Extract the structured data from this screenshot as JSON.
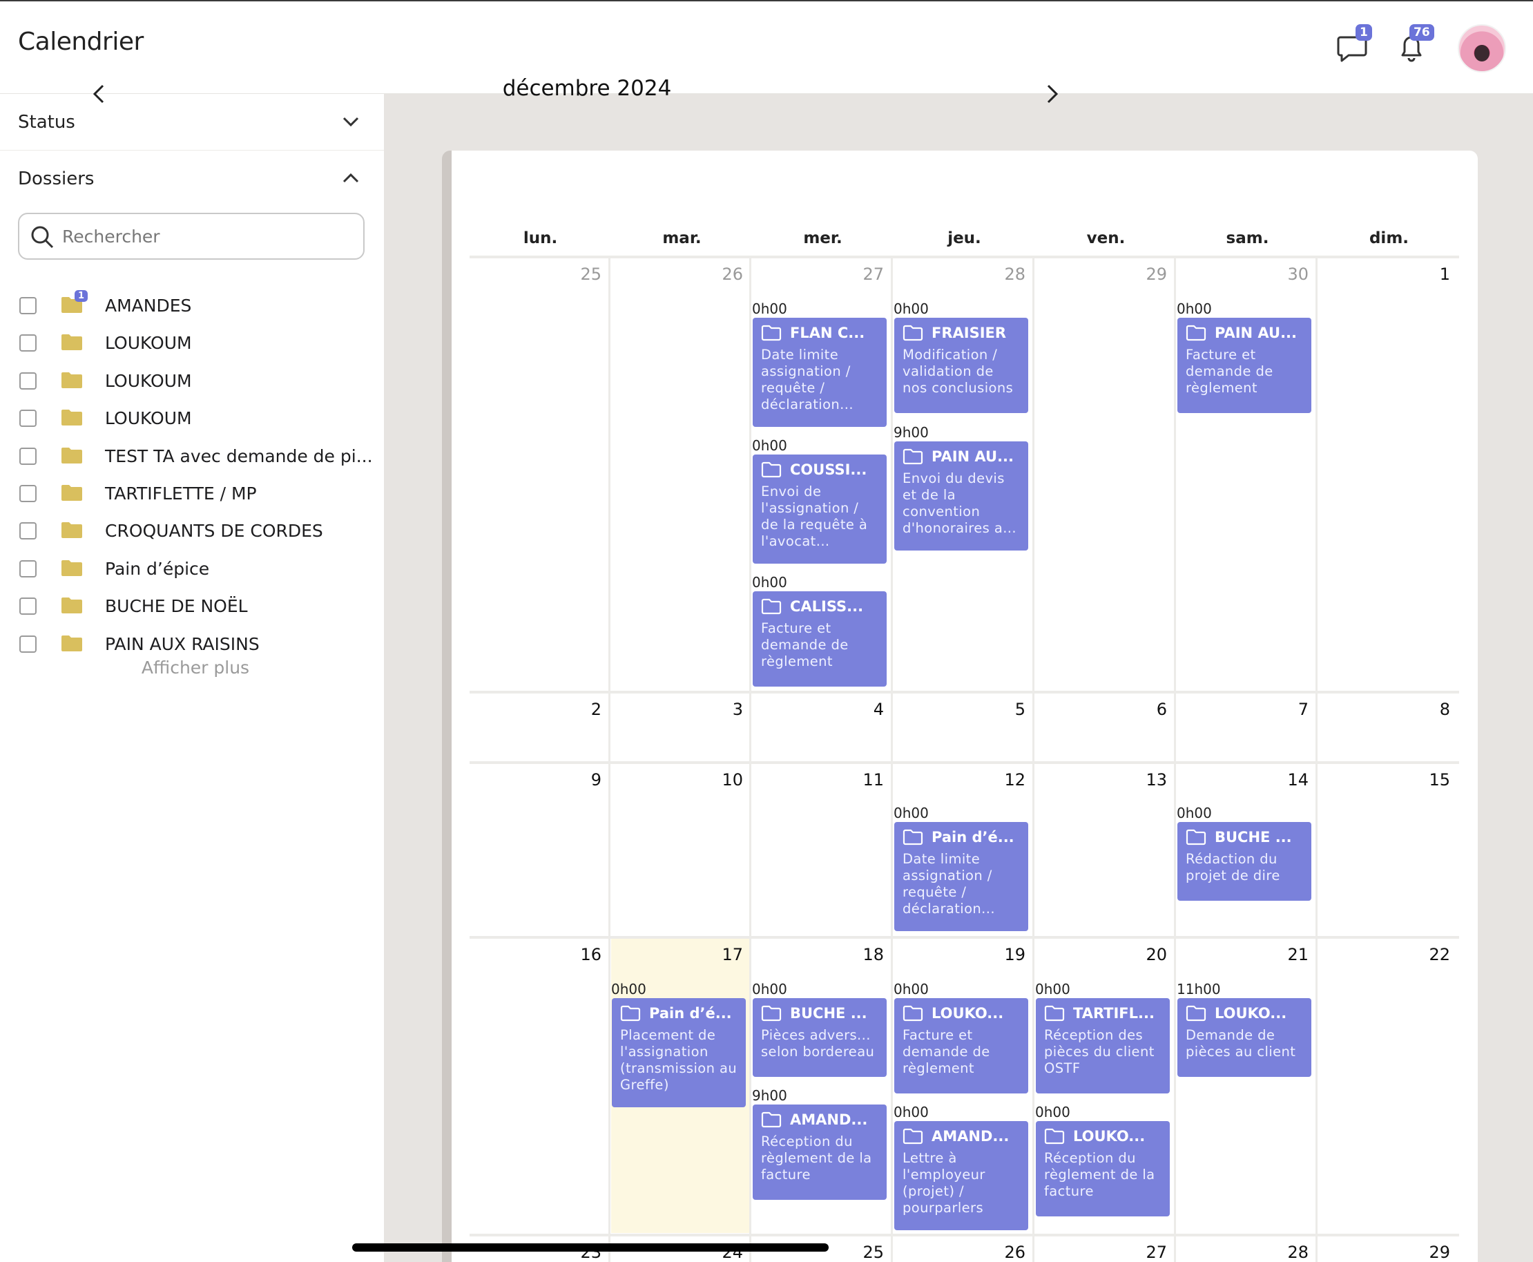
{
  "header": {
    "title": "Calendrier",
    "messages_badge": "1",
    "notifications_badge": "76"
  },
  "sidebar": {
    "status_label": "Status",
    "dossiers_label": "Dossiers",
    "search_placeholder": "Rechercher",
    "dossiers": [
      {
        "name": "AMANDES",
        "badge": "1"
      },
      {
        "name": "LOUKOUM"
      },
      {
        "name": "LOUKOUM"
      },
      {
        "name": "LOUKOUM"
      },
      {
        "name": "TEST TA avec demande de pi..."
      },
      {
        "name": "TARTIFLETTE / MP"
      },
      {
        "name": "CROQUANTS DE CORDES"
      },
      {
        "name": "Pain d’épice"
      },
      {
        "name": "BUCHE DE NOËL"
      },
      {
        "name": "PAIN AUX RAISINS"
      }
    ],
    "show_more": "Afficher plus"
  },
  "calendar": {
    "month_label": "décembre 2024",
    "weekdays": [
      "lun.",
      "mar.",
      "mer.",
      "jeu.",
      "ven.",
      "sam.",
      "dim."
    ],
    "weeks": [
      [
        "25",
        "26",
        "27",
        "28",
        "29",
        "30",
        "1"
      ],
      [
        "2",
        "3",
        "4",
        "5",
        "6",
        "7",
        "8"
      ],
      [
        "9",
        "10",
        "11",
        "12",
        "13",
        "14",
        "15"
      ],
      [
        "16",
        "17",
        "18",
        "19",
        "20",
        "21",
        "22"
      ],
      [
        "23",
        "24",
        "25",
        "26",
        "27",
        "28",
        "29"
      ]
    ],
    "events": [
      {
        "time": "0h00",
        "title": "FLAN C...",
        "desc": "Date limite assignation / requête / déclaration..."
      },
      {
        "time": "0h00",
        "title": "COUSSI...",
        "desc": "Envoi de l'assignation / de la requête à l'avocat..."
      },
      {
        "time": "0h00",
        "title": "CALISS...",
        "desc": "Facture et demande de règlement"
      },
      {
        "time": "0h00",
        "title": "FRAISIER",
        "desc": "Modification / validation de nos conclusions"
      },
      {
        "time": "9h00",
        "title": "PAIN AU...",
        "desc": "Envoi du devis et de la convention d'honoraires a..."
      },
      {
        "time": "0h00",
        "title": "PAIN AU...",
        "desc": "Facture et demande de règlement"
      },
      {
        "time": "0h00",
        "title": "Pain d’é...",
        "desc": "Date limite assignation / requête / déclaration..."
      },
      {
        "time": "0h00",
        "title": "BUCHE ...",
        "desc": "Rédaction du projet de dire"
      },
      {
        "time": "0h00",
        "title": "Pain d’é...",
        "desc": "Placement de l'assignation (transmission au Greffe)"
      },
      {
        "time": "0h00",
        "title": "BUCHE ...",
        "desc": "Pièces advers... selon bordereau"
      },
      {
        "time": "9h00",
        "title": "AMAND...",
        "desc": "Réception du règlement de la facture"
      },
      {
        "time": "0h00",
        "title": "LOUKO...",
        "desc": "Facture et demande de règlement"
      },
      {
        "time": "0h00",
        "title": "AMAND...",
        "desc": "Lettre à l'employeur (projet) / pourparlers"
      },
      {
        "time": "0h00",
        "title": "TARTIFL...",
        "desc": "Réception des pièces du client OSTF"
      },
      {
        "time": "0h00",
        "title": "LOUKO...",
        "desc": "Réception du règlement de la facture"
      },
      {
        "time": "11h00",
        "title": "LOUKO...",
        "desc": "Demande de pièces au client"
      }
    ]
  },
  "colors": {
    "event_bg": "#7a81db",
    "badge_bg": "#6b73d9",
    "folder": "#d9bf5e",
    "today_bg": "#fdf8e1",
    "main_bg": "#e7e4e1"
  },
  "icons": [
    "chat-icon",
    "bell-icon",
    "chevron-down-icon",
    "chevron-up-icon",
    "search-icon",
    "folder-icon",
    "chevron-left-icon",
    "chevron-right-icon"
  ]
}
